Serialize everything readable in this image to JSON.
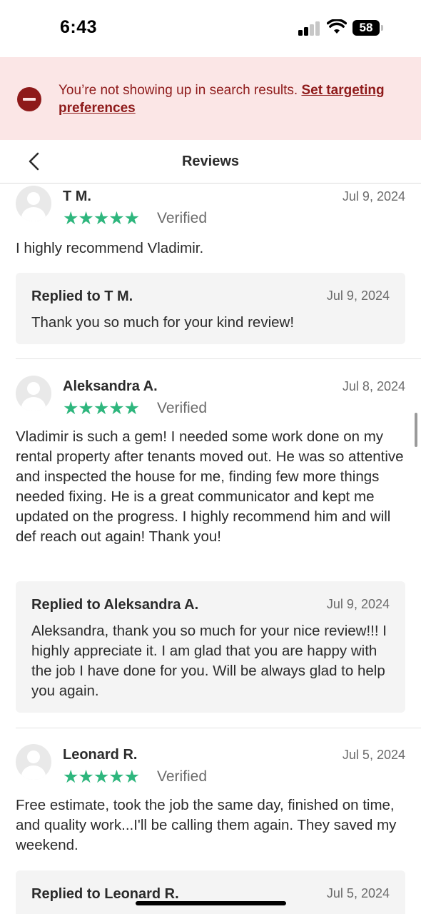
{
  "status_bar": {
    "time": "6:43",
    "battery": "58"
  },
  "alert": {
    "message": "You’re not showing up in search results. ",
    "link_text": "Set targeting preferences"
  },
  "nav": {
    "title": "Reviews"
  },
  "reviews": [
    {
      "name": "T M.",
      "date": "Jul 9, 2024",
      "rating": 5,
      "stars": "★★★★★",
      "verified": "Verified",
      "body": "I highly recommend Vladimir.",
      "reply": {
        "title": "Replied to T M.",
        "date": "Jul 9, 2024",
        "body": "Thank you so much for your kind review!"
      }
    },
    {
      "name": "Aleksandra A.",
      "date": "Jul 8, 2024",
      "rating": 5,
      "stars": "★★★★★",
      "verified": "Verified",
      "body": "Vladimir is such a gem! I needed some work done on my rental property after tenants moved out. He was so attentive and inspected the house for me, finding few more things needed fixing. He is a great communicator and kept me updated on the progress. I highly recommend him and will def reach out again! Thank you!",
      "reply": {
        "title": "Replied to Aleksandra A.",
        "date": "Jul 9, 2024",
        "body": "Aleksandra, thank you so much for your nice review!!! I highly appreciate it. I am glad that you are happy with the job I have done for you. Will be always glad to help you again."
      }
    },
    {
      "name": "Leonard R.",
      "date": "Jul 5, 2024",
      "rating": 5,
      "stars": "★★★★★",
      "verified": "Verified",
      "body": "Free estimate, took the job the same day, finished on time, and quality work...I'll be calling them again. They saved my weekend.",
      "reply": {
        "title": "Replied to Leonard R.",
        "date": "Jul 5, 2024",
        "body": ""
      }
    }
  ],
  "colors": {
    "star": "#2eb67d",
    "alert_bg": "#fbe6e6",
    "alert_text": "#8e1a1a"
  }
}
